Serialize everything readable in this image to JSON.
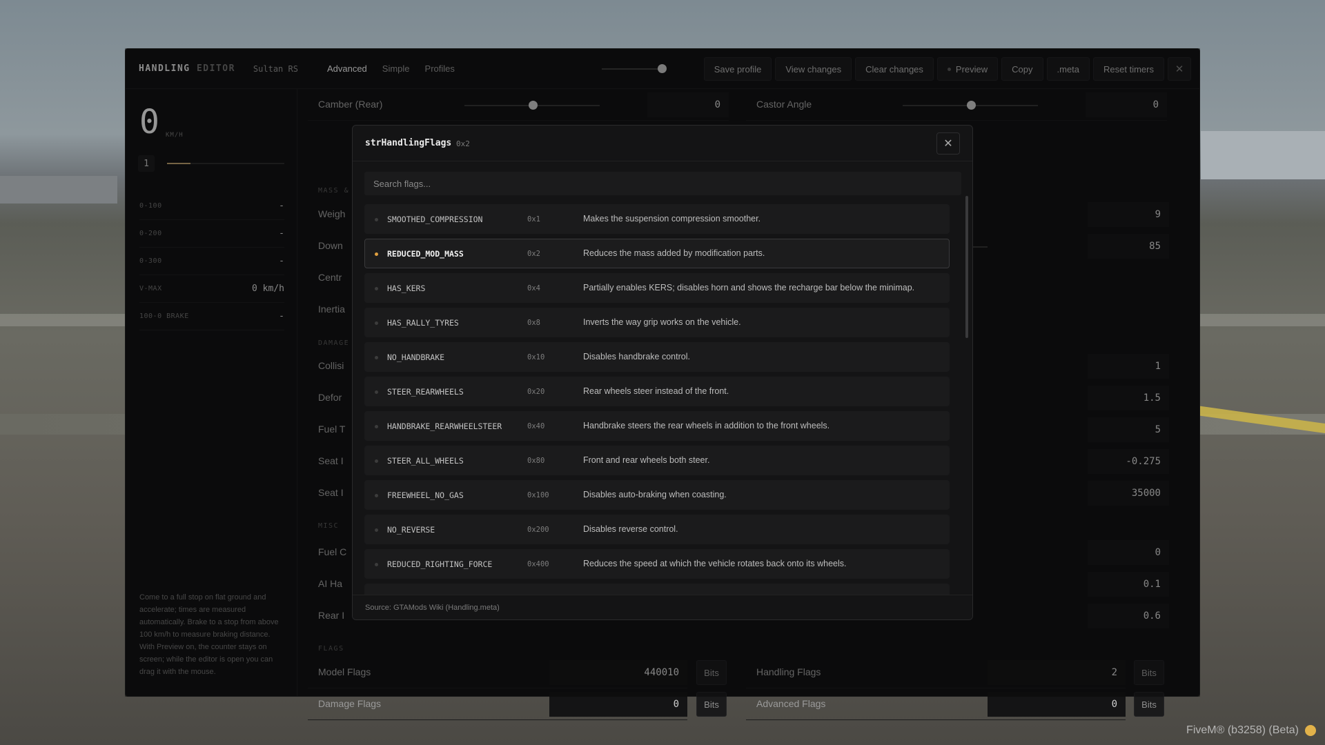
{
  "app": {
    "brand_primary": "HANDLING",
    "brand_secondary": "EDITOR",
    "vehicle": "Sultan RS",
    "tabs": [
      "Advanced",
      "Simple",
      "Profiles"
    ],
    "active_tab": "Advanced"
  },
  "toolbar": {
    "save_profile": "Save profile",
    "view_changes": "View changes",
    "clear_changes": "Clear changes",
    "preview": "Preview",
    "copy": "Copy",
    "meta": ".meta",
    "reset_timers": "Reset timers",
    "close": "✕"
  },
  "sidebar": {
    "speed": "0",
    "unit": "KM/H",
    "gear": "1",
    "rpm_fraction": 0.2,
    "stats": [
      {
        "k": "0-100",
        "v": "-"
      },
      {
        "k": "0-200",
        "v": "-"
      },
      {
        "k": "0-300",
        "v": "-"
      },
      {
        "k": "V-MAX",
        "v": "0 km/h"
      },
      {
        "k": "100-0 BRAKE",
        "v": "-"
      }
    ],
    "help": "Come to a full stop on flat ground and accelerate; times are measured automatically. Brake to a stop from above 100 km/h to measure braking distance. With Preview on, the counter stays on screen; while the editor is open you can drag it with the mouse."
  },
  "main": {
    "sections": {
      "mass": "MASS &",
      "damage": "DAMAGE",
      "misc": "MISC",
      "flags": "FLAGS"
    },
    "top_rows": [
      {
        "label": "Camber (Rear)",
        "value": "0",
        "slider": 0.5
      },
      {
        "label": "Castor Angle",
        "value": "0",
        "slider": 0.5
      }
    ],
    "left_labels": [
      "Weigh",
      "Down",
      "Centr",
      "Inertia",
      "Collisi",
      "Defor",
      "Fuel T",
      "Seat I",
      "Seat I",
      "Fuel C",
      "AI Ha",
      "Rear I"
    ],
    "right_values": [
      "9",
      "85",
      "1",
      "1.5",
      "5",
      "-0.275",
      "35000",
      "0",
      "0.1",
      "0.6"
    ],
    "down_slider": 0.7,
    "flag_rows": [
      {
        "label": "Model Flags",
        "value": "440010",
        "bits": "Bits"
      },
      {
        "label": "Handling Flags",
        "value": "2",
        "bits": "Bits"
      },
      {
        "label": "Damage Flags",
        "value": "0",
        "bits": "Bits"
      },
      {
        "label": "Advanced Flags",
        "value": "0",
        "bits": "Bits"
      }
    ]
  },
  "modal": {
    "title": "strHandlingFlags",
    "hex": "0x2",
    "close": "✕",
    "search_placeholder": "Search flags...",
    "flags": [
      {
        "name": "SMOOTHED_COMPRESSION",
        "hex": "0x1",
        "desc": "Makes the suspension compression smoother.",
        "active": false
      },
      {
        "name": "REDUCED_MOD_MASS",
        "hex": "0x2",
        "desc": "Reduces the mass added by modification parts.",
        "active": true
      },
      {
        "name": "HAS_KERS",
        "hex": "0x4",
        "desc": "Partially enables KERS; disables horn and shows the recharge bar below the minimap.",
        "active": false
      },
      {
        "name": "HAS_RALLY_TYRES",
        "hex": "0x8",
        "desc": "Inverts the way grip works on the vehicle.",
        "active": false
      },
      {
        "name": "NO_HANDBRAKE",
        "hex": "0x10",
        "desc": "Disables handbrake control.",
        "active": false
      },
      {
        "name": "STEER_REARWHEELS",
        "hex": "0x20",
        "desc": "Rear wheels steer instead of the front.",
        "active": false
      },
      {
        "name": "HANDBRAKE_REARWHEELSTEER",
        "hex": "0x40",
        "desc": "Handbrake steers the rear wheels in addition to the front wheels.",
        "active": false
      },
      {
        "name": "STEER_ALL_WHEELS",
        "hex": "0x80",
        "desc": "Front and rear wheels both steer.",
        "active": false
      },
      {
        "name": "FREEWHEEL_NO_GAS",
        "hex": "0x100",
        "desc": "Disables auto-braking when coasting.",
        "active": false
      },
      {
        "name": "NO_REVERSE",
        "hex": "0x200",
        "desc": "Disables reverse control.",
        "active": false
      },
      {
        "name": "REDUCED_RIGHTING_FORCE",
        "hex": "0x400",
        "desc": "Reduces the speed at which the vehicle rotates back onto its wheels.",
        "active": false
      }
    ],
    "source": "Source: GTAMods Wiki (Handling.meta)"
  },
  "overlay_label": "FiveM® (b3258) (Beta)",
  "colors": {
    "accent": "#e0a040",
    "panel": "#121213"
  }
}
